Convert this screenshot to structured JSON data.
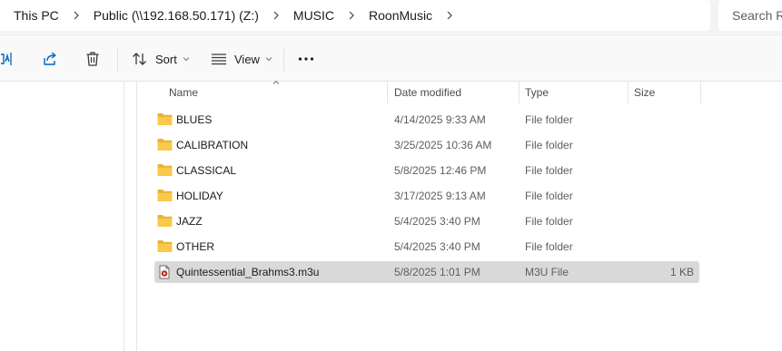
{
  "breadcrumb": {
    "items": [
      "This PC",
      "Public (\\\\192.168.50.171) (Z:)",
      "MUSIC",
      "RoonMusic"
    ]
  },
  "search": {
    "placeholder": "Search R"
  },
  "toolbar": {
    "sort_label": "Sort",
    "view_label": "View"
  },
  "columns": {
    "name": "Name",
    "date": "Date modified",
    "type": "Type",
    "size": "Size"
  },
  "files": [
    {
      "name": "BLUES",
      "date": "4/14/2025 9:33 AM",
      "type": "File folder",
      "size": "",
      "icon": "folder-icon"
    },
    {
      "name": "CALIBRATION",
      "date": "3/25/2025 10:36 AM",
      "type": "File folder",
      "size": "",
      "icon": "folder-icon"
    },
    {
      "name": "CLASSICAL",
      "date": "5/8/2025 12:46 PM",
      "type": "File folder",
      "size": "",
      "icon": "folder-icon"
    },
    {
      "name": "HOLIDAY",
      "date": "3/17/2025 9:13 AM",
      "type": "File folder",
      "size": "",
      "icon": "folder-icon"
    },
    {
      "name": "JAZZ",
      "date": "5/4/2025 3:40 PM",
      "type": "File folder",
      "size": "",
      "icon": "folder-icon"
    },
    {
      "name": "OTHER",
      "date": "5/4/2025 3:40 PM",
      "type": "File folder",
      "size": "",
      "icon": "folder-icon"
    },
    {
      "name": "Quintessential_Brahms3.m3u",
      "date": "5/8/2025 1:01 PM",
      "type": "M3U File",
      "size": "1 KB",
      "icon": "playlist-file-icon",
      "selected": true
    }
  ],
  "colors": {
    "folder": "#f8c94a",
    "selected_row": "#d9d9d9",
    "accent": "#0067c0"
  }
}
